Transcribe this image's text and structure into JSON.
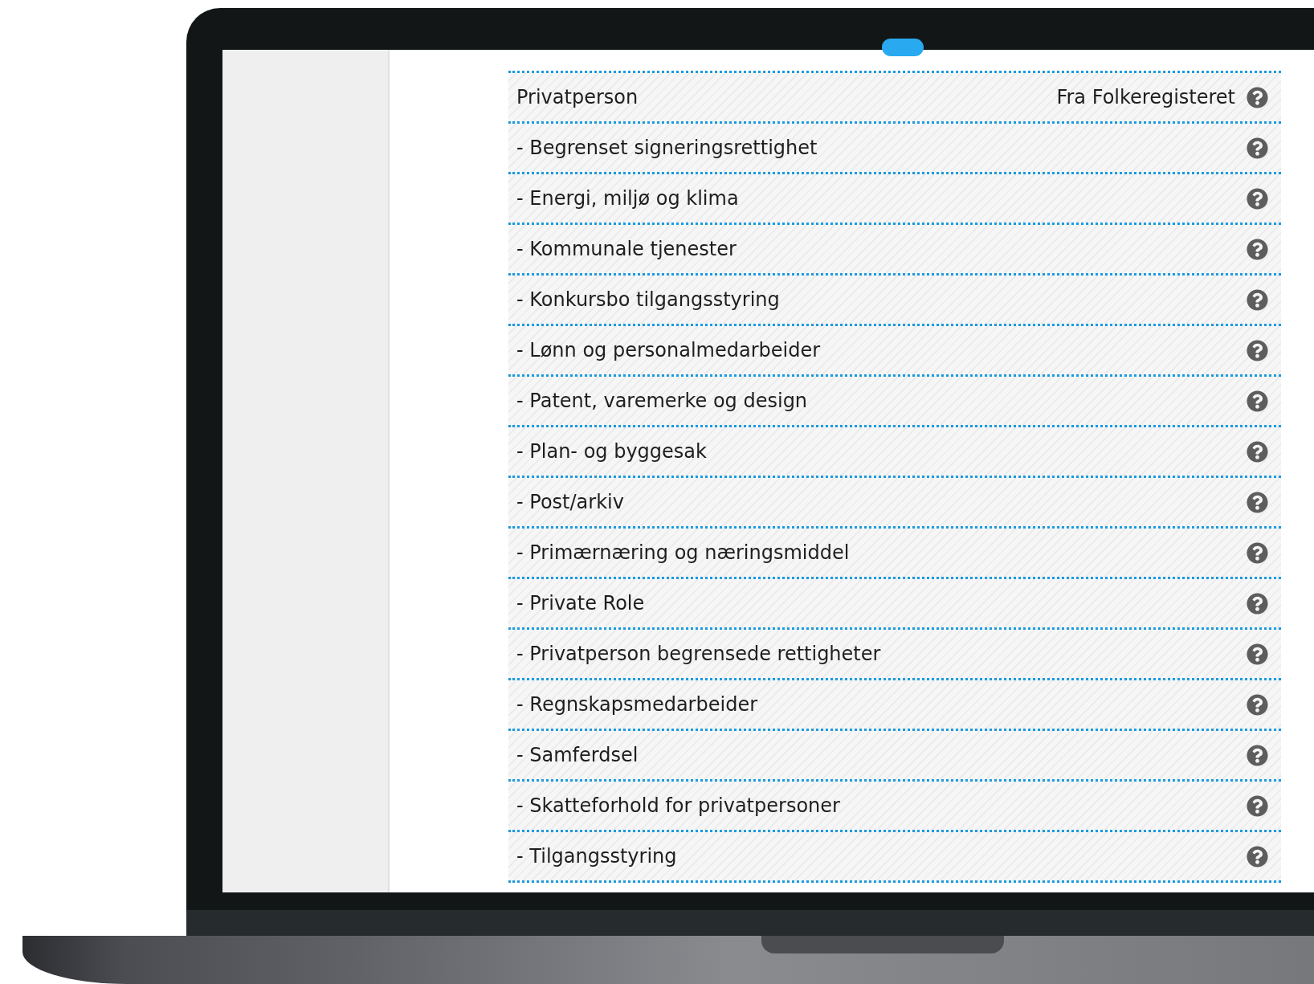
{
  "header_row": {
    "label": "Privatperson",
    "source": "Fra Folkeregisteret"
  },
  "roles": [
    {
      "label": "- Begrenset signeringsrettighet"
    },
    {
      "label": "- Energi, miljø og klima"
    },
    {
      "label": "- Kommunale tjenester"
    },
    {
      "label": "- Konkursbo tilgangsstyring"
    },
    {
      "label": "- Lønn og personalmedarbeider"
    },
    {
      "label": "- Patent, varemerke og design"
    },
    {
      "label": "- Plan- og byggesak"
    },
    {
      "label": "- Post/arkiv"
    },
    {
      "label": "- Primærnæring og næringsmiddel"
    },
    {
      "label": "- Private Role"
    },
    {
      "label": "- Privatperson begrensede rettigheter"
    },
    {
      "label": "- Regnskapsmedarbeider"
    },
    {
      "label": "- Samferdsel"
    },
    {
      "label": "- Skatteforhold for privatpersoner"
    },
    {
      "label": "- Tilgangsstyring"
    }
  ]
}
